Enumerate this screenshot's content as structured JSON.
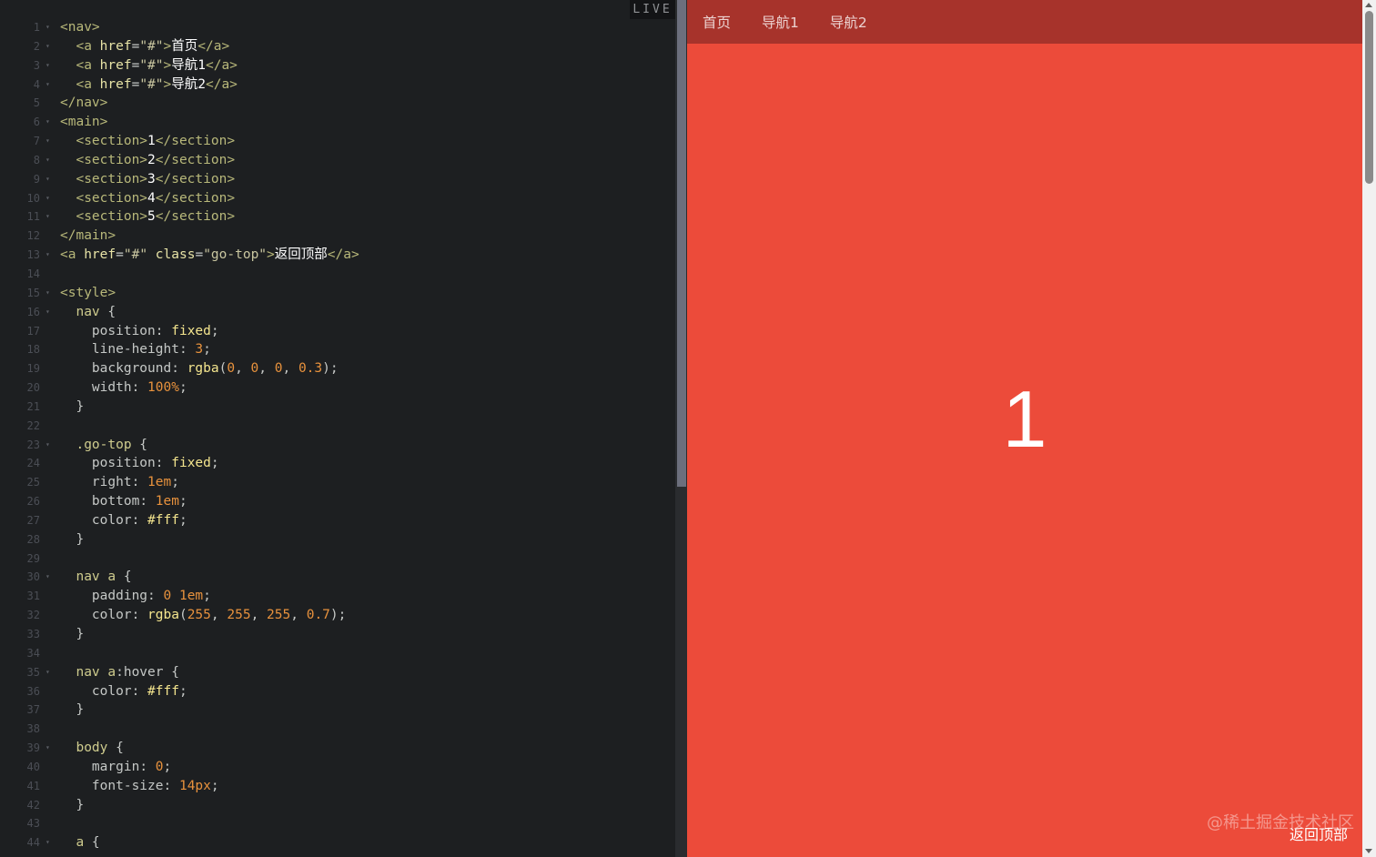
{
  "editor": {
    "live_label": "LIVE",
    "lines": [
      {
        "n": "1",
        "fold": "▾",
        "tokens": [
          {
            "c": "t-tag",
            "t": "<nav>"
          }
        ]
      },
      {
        "n": "2",
        "fold": "▾",
        "tokens": [
          {
            "c": "t-tag",
            "t": "  <a "
          },
          {
            "c": "t-attr",
            "t": "href"
          },
          {
            "c": "t-punc",
            "t": "="
          },
          {
            "c": "t-str",
            "t": "\"#\""
          },
          {
            "c": "t-tag",
            "t": ">"
          },
          {
            "c": "t-text",
            "t": "首页"
          },
          {
            "c": "t-tag",
            "t": "</a>"
          }
        ]
      },
      {
        "n": "3",
        "fold": "▾",
        "tokens": [
          {
            "c": "t-tag",
            "t": "  <a "
          },
          {
            "c": "t-attr",
            "t": "href"
          },
          {
            "c": "t-punc",
            "t": "="
          },
          {
            "c": "t-str",
            "t": "\"#\""
          },
          {
            "c": "t-tag",
            "t": ">"
          },
          {
            "c": "t-text",
            "t": "导航1"
          },
          {
            "c": "t-tag",
            "t": "</a>"
          }
        ]
      },
      {
        "n": "4",
        "fold": "▾",
        "tokens": [
          {
            "c": "t-tag",
            "t": "  <a "
          },
          {
            "c": "t-attr",
            "t": "href"
          },
          {
            "c": "t-punc",
            "t": "="
          },
          {
            "c": "t-str",
            "t": "\"#\""
          },
          {
            "c": "t-tag",
            "t": ">"
          },
          {
            "c": "t-text",
            "t": "导航2"
          },
          {
            "c": "t-tag",
            "t": "</a>"
          }
        ]
      },
      {
        "n": "5",
        "fold": "",
        "tokens": [
          {
            "c": "t-tag",
            "t": "</nav>"
          }
        ]
      },
      {
        "n": "6",
        "fold": "▾",
        "tokens": [
          {
            "c": "t-tag",
            "t": "<main>"
          }
        ]
      },
      {
        "n": "7",
        "fold": "▾",
        "tokens": [
          {
            "c": "t-tag",
            "t": "  <section>"
          },
          {
            "c": "t-text",
            "t": "1"
          },
          {
            "c": "t-tag",
            "t": "</section>"
          }
        ]
      },
      {
        "n": "8",
        "fold": "▾",
        "tokens": [
          {
            "c": "t-tag",
            "t": "  <section>"
          },
          {
            "c": "t-text",
            "t": "2"
          },
          {
            "c": "t-tag",
            "t": "</section>"
          }
        ]
      },
      {
        "n": "9",
        "fold": "▾",
        "tokens": [
          {
            "c": "t-tag",
            "t": "  <section>"
          },
          {
            "c": "t-text",
            "t": "3"
          },
          {
            "c": "t-tag",
            "t": "</section>"
          }
        ]
      },
      {
        "n": "10",
        "fold": "▾",
        "tokens": [
          {
            "c": "t-tag",
            "t": "  <section>"
          },
          {
            "c": "t-text",
            "t": "4"
          },
          {
            "c": "t-tag",
            "t": "</section>"
          }
        ]
      },
      {
        "n": "11",
        "fold": "▾",
        "tokens": [
          {
            "c": "t-tag",
            "t": "  <section>"
          },
          {
            "c": "t-text",
            "t": "5"
          },
          {
            "c": "t-tag",
            "t": "</section>"
          }
        ]
      },
      {
        "n": "12",
        "fold": "",
        "tokens": [
          {
            "c": "t-tag",
            "t": "</main>"
          }
        ]
      },
      {
        "n": "13",
        "fold": "▾",
        "tokens": [
          {
            "c": "t-tag",
            "t": "<a "
          },
          {
            "c": "t-attr",
            "t": "href"
          },
          {
            "c": "t-punc",
            "t": "="
          },
          {
            "c": "t-str",
            "t": "\"#\""
          },
          {
            "c": "t-punc",
            "t": " "
          },
          {
            "c": "t-attr",
            "t": "class"
          },
          {
            "c": "t-punc",
            "t": "="
          },
          {
            "c": "t-str",
            "t": "\"go-top\""
          },
          {
            "c": "t-tag",
            "t": ">"
          },
          {
            "c": "t-text",
            "t": "返回顶部"
          },
          {
            "c": "t-tag",
            "t": "</a>"
          }
        ]
      },
      {
        "n": "14",
        "fold": "",
        "tokens": []
      },
      {
        "n": "15",
        "fold": "▾",
        "tokens": [
          {
            "c": "t-tag",
            "t": "<style>"
          }
        ]
      },
      {
        "n": "16",
        "fold": "▾",
        "tokens": [
          {
            "c": "t-sel",
            "t": "  nav"
          },
          {
            "c": "t-punc",
            "t": " {"
          }
        ]
      },
      {
        "n": "17",
        "fold": "",
        "tokens": [
          {
            "c": "t-prop",
            "t": "    position"
          },
          {
            "c": "t-punc",
            "t": ": "
          },
          {
            "c": "t-val",
            "t": "fixed"
          },
          {
            "c": "t-punc",
            "t": ";"
          }
        ]
      },
      {
        "n": "18",
        "fold": "",
        "tokens": [
          {
            "c": "t-prop",
            "t": "    line-height"
          },
          {
            "c": "t-punc",
            "t": ": "
          },
          {
            "c": "t-num",
            "t": "3"
          },
          {
            "c": "t-punc",
            "t": ";"
          }
        ]
      },
      {
        "n": "19",
        "fold": "",
        "tokens": [
          {
            "c": "t-prop",
            "t": "    background"
          },
          {
            "c": "t-punc",
            "t": ": "
          },
          {
            "c": "t-val",
            "t": "rgba"
          },
          {
            "c": "t-punc",
            "t": "("
          },
          {
            "c": "t-num",
            "t": "0"
          },
          {
            "c": "t-punc",
            "t": ", "
          },
          {
            "c": "t-num",
            "t": "0"
          },
          {
            "c": "t-punc",
            "t": ", "
          },
          {
            "c": "t-num",
            "t": "0"
          },
          {
            "c": "t-punc",
            "t": ", "
          },
          {
            "c": "t-num",
            "t": "0.3"
          },
          {
            "c": "t-punc",
            "t": ");"
          }
        ]
      },
      {
        "n": "20",
        "fold": "",
        "tokens": [
          {
            "c": "t-prop",
            "t": "    width"
          },
          {
            "c": "t-punc",
            "t": ": "
          },
          {
            "c": "t-num",
            "t": "100%"
          },
          {
            "c": "t-punc",
            "t": ";"
          }
        ]
      },
      {
        "n": "21",
        "fold": "",
        "tokens": [
          {
            "c": "t-punc",
            "t": "  }"
          }
        ]
      },
      {
        "n": "22",
        "fold": "",
        "tokens": []
      },
      {
        "n": "23",
        "fold": "▾",
        "tokens": [
          {
            "c": "t-sel",
            "t": "  .go-top"
          },
          {
            "c": "t-punc",
            "t": " {"
          }
        ]
      },
      {
        "n": "24",
        "fold": "",
        "tokens": [
          {
            "c": "t-prop",
            "t": "    position"
          },
          {
            "c": "t-punc",
            "t": ": "
          },
          {
            "c": "t-val",
            "t": "fixed"
          },
          {
            "c": "t-punc",
            "t": ";"
          }
        ]
      },
      {
        "n": "25",
        "fold": "",
        "tokens": [
          {
            "c": "t-prop",
            "t": "    right"
          },
          {
            "c": "t-punc",
            "t": ": "
          },
          {
            "c": "t-num",
            "t": "1em"
          },
          {
            "c": "t-punc",
            "t": ";"
          }
        ]
      },
      {
        "n": "26",
        "fold": "",
        "tokens": [
          {
            "c": "t-prop",
            "t": "    bottom"
          },
          {
            "c": "t-punc",
            "t": ": "
          },
          {
            "c": "t-num",
            "t": "1em"
          },
          {
            "c": "t-punc",
            "t": ";"
          }
        ]
      },
      {
        "n": "27",
        "fold": "",
        "tokens": [
          {
            "c": "t-prop",
            "t": "    color"
          },
          {
            "c": "t-punc",
            "t": ": "
          },
          {
            "c": "t-val",
            "t": "#fff"
          },
          {
            "c": "t-punc",
            "t": ";"
          }
        ]
      },
      {
        "n": "28",
        "fold": "",
        "tokens": [
          {
            "c": "t-punc",
            "t": "  }"
          }
        ]
      },
      {
        "n": "29",
        "fold": "",
        "tokens": []
      },
      {
        "n": "30",
        "fold": "▾",
        "tokens": [
          {
            "c": "t-sel",
            "t": "  nav a"
          },
          {
            "c": "t-punc",
            "t": " {"
          }
        ]
      },
      {
        "n": "31",
        "fold": "",
        "tokens": [
          {
            "c": "t-prop",
            "t": "    padding"
          },
          {
            "c": "t-punc",
            "t": ": "
          },
          {
            "c": "t-num",
            "t": "0"
          },
          {
            "c": "t-punc",
            "t": " "
          },
          {
            "c": "t-num",
            "t": "1em"
          },
          {
            "c": "t-punc",
            "t": ";"
          }
        ]
      },
      {
        "n": "32",
        "fold": "",
        "tokens": [
          {
            "c": "t-prop",
            "t": "    color"
          },
          {
            "c": "t-punc",
            "t": ": "
          },
          {
            "c": "t-val",
            "t": "rgba"
          },
          {
            "c": "t-punc",
            "t": "("
          },
          {
            "c": "t-num",
            "t": "255"
          },
          {
            "c": "t-punc",
            "t": ", "
          },
          {
            "c": "t-num",
            "t": "255"
          },
          {
            "c": "t-punc",
            "t": ", "
          },
          {
            "c": "t-num",
            "t": "255"
          },
          {
            "c": "t-punc",
            "t": ", "
          },
          {
            "c": "t-num",
            "t": "0.7"
          },
          {
            "c": "t-punc",
            "t": ");"
          }
        ]
      },
      {
        "n": "33",
        "fold": "",
        "tokens": [
          {
            "c": "t-punc",
            "t": "  }"
          }
        ]
      },
      {
        "n": "34",
        "fold": "",
        "tokens": []
      },
      {
        "n": "35",
        "fold": "▾",
        "tokens": [
          {
            "c": "t-sel",
            "t": "  nav a"
          },
          {
            "c": "t-punc",
            "t": ":hover {"
          }
        ]
      },
      {
        "n": "36",
        "fold": "",
        "tokens": [
          {
            "c": "t-prop",
            "t": "    color"
          },
          {
            "c": "t-punc",
            "t": ": "
          },
          {
            "c": "t-val",
            "t": "#fff"
          },
          {
            "c": "t-punc",
            "t": ";"
          }
        ]
      },
      {
        "n": "37",
        "fold": "",
        "tokens": [
          {
            "c": "t-punc",
            "t": "  }"
          }
        ]
      },
      {
        "n": "38",
        "fold": "",
        "tokens": []
      },
      {
        "n": "39",
        "fold": "▾",
        "tokens": [
          {
            "c": "t-sel",
            "t": "  body"
          },
          {
            "c": "t-punc",
            "t": " {"
          }
        ]
      },
      {
        "n": "40",
        "fold": "",
        "tokens": [
          {
            "c": "t-prop",
            "t": "    margin"
          },
          {
            "c": "t-punc",
            "t": ": "
          },
          {
            "c": "t-num",
            "t": "0"
          },
          {
            "c": "t-punc",
            "t": ";"
          }
        ]
      },
      {
        "n": "41",
        "fold": "",
        "tokens": [
          {
            "c": "t-prop",
            "t": "    font-size"
          },
          {
            "c": "t-punc",
            "t": ": "
          },
          {
            "c": "t-num",
            "t": "14px"
          },
          {
            "c": "t-punc",
            "t": ";"
          }
        ]
      },
      {
        "n": "42",
        "fold": "",
        "tokens": [
          {
            "c": "t-punc",
            "t": "  }"
          }
        ]
      },
      {
        "n": "43",
        "fold": "",
        "tokens": []
      },
      {
        "n": "44",
        "fold": "▾",
        "tokens": [
          {
            "c": "t-sel",
            "t": "  a"
          },
          {
            "c": "t-punc",
            "t": " {"
          }
        ]
      }
    ]
  },
  "preview": {
    "nav": [
      {
        "label": "首页"
      },
      {
        "label": "导航1"
      },
      {
        "label": "导航2"
      }
    ],
    "section_number": "1",
    "go_top_label": "返回顶部",
    "watermark": "@稀土掘金技术社区",
    "background_color": "#ec4b3a",
    "nav_color": "#a7332b"
  }
}
